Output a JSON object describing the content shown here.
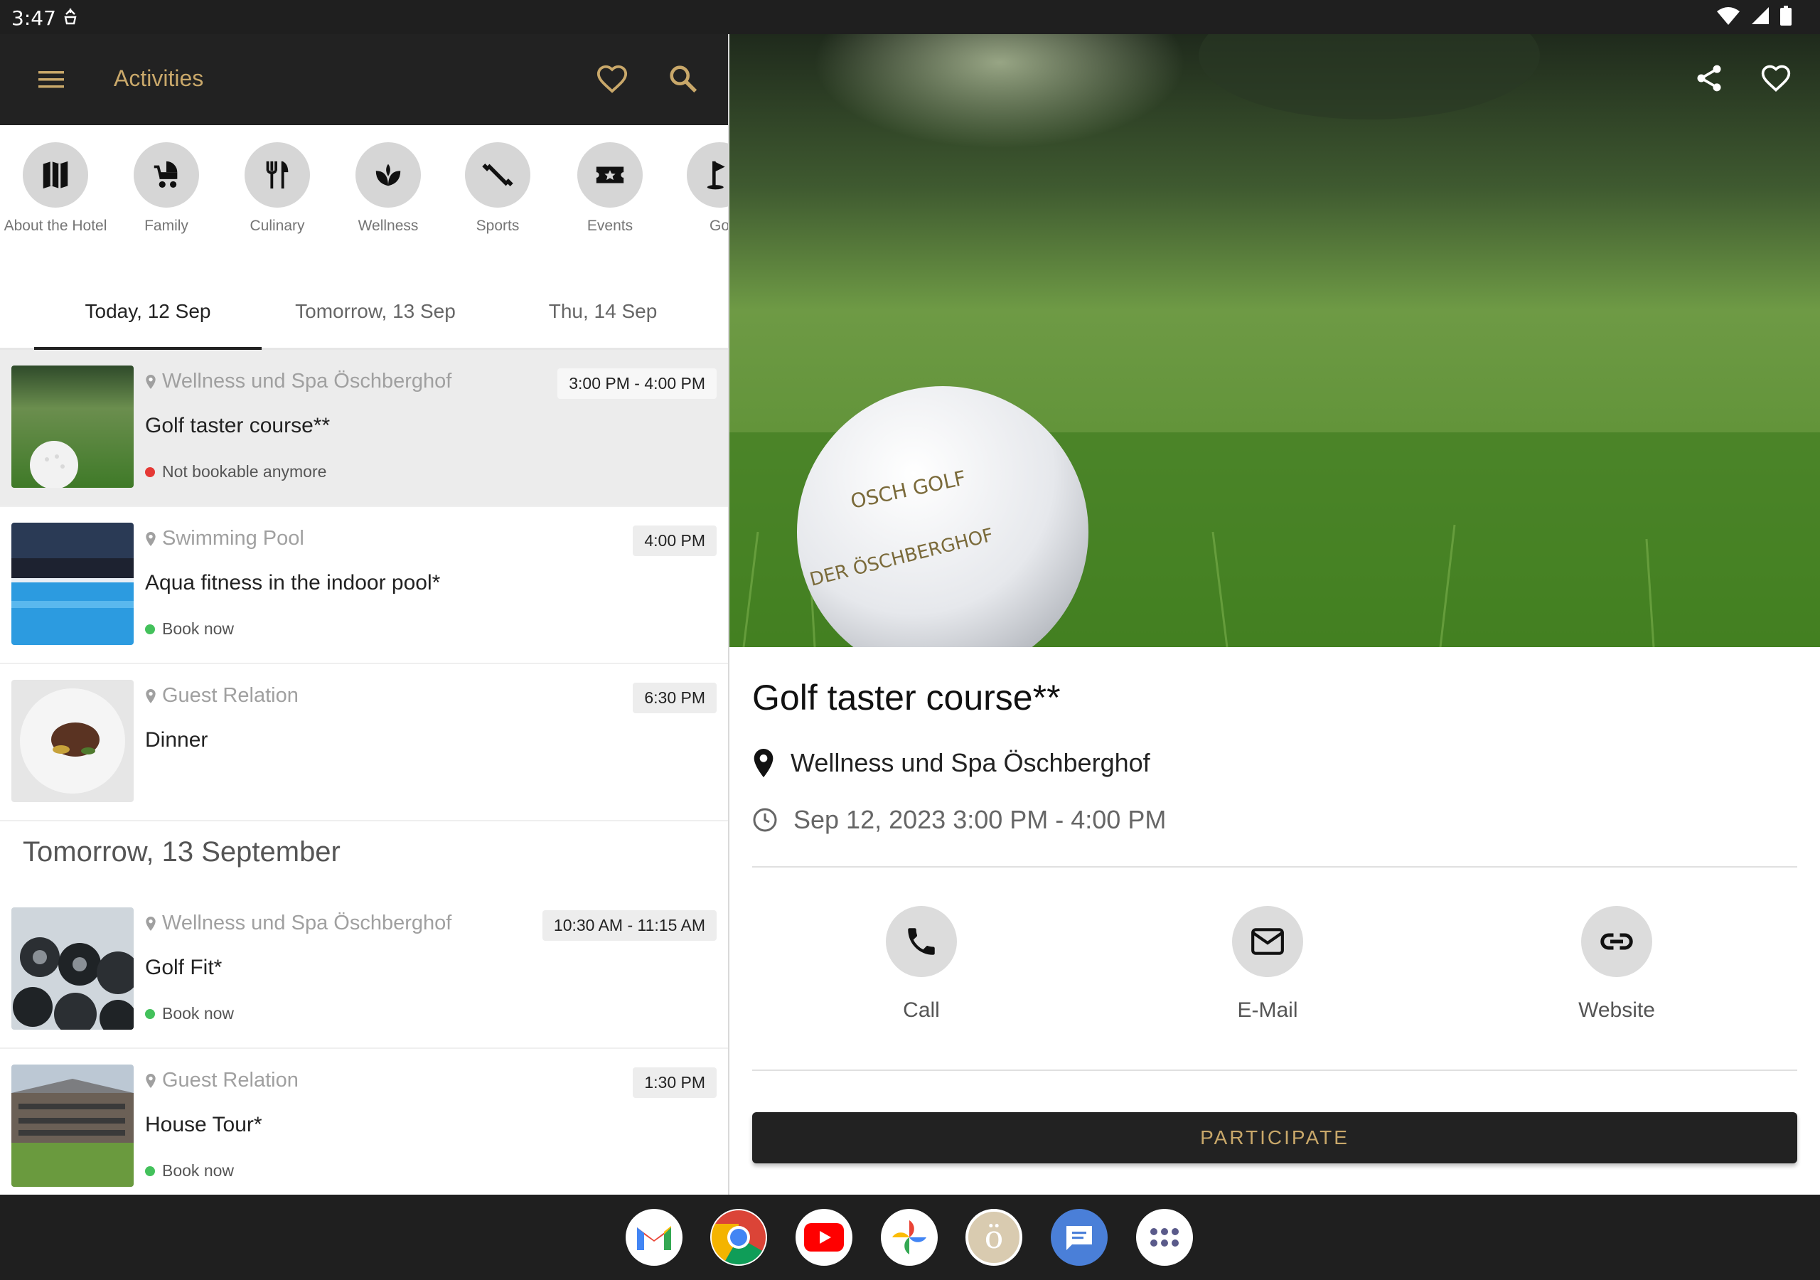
{
  "status_bar": {
    "time": "3:47"
  },
  "app_bar": {
    "title": "Activities"
  },
  "categories": [
    {
      "label": "About the Hotel",
      "icon": "map-icon"
    },
    {
      "label": "Family",
      "icon": "stroller-icon"
    },
    {
      "label": "Culinary",
      "icon": "cutlery-icon"
    },
    {
      "label": "Wellness",
      "icon": "lotus-icon"
    },
    {
      "label": "Sports",
      "icon": "dumbbell-icon"
    },
    {
      "label": "Events",
      "icon": "ticket-icon"
    },
    {
      "label": "Go",
      "icon": "golf-flag-icon"
    }
  ],
  "tabs": [
    {
      "label": "Today, 12 Sep",
      "active": true
    },
    {
      "label": "Tomorrow, 13 Sep",
      "active": false
    },
    {
      "label": "Thu, 14 Sep",
      "active": false
    }
  ],
  "today_items": [
    {
      "location": "Wellness und Spa Öschberghof",
      "time": "3:00 PM - 4:00 PM",
      "title": "Golf taster course**",
      "status": "Not bookable anymore",
      "status_color": "#e53935",
      "selected": true
    },
    {
      "location": "Swimming Pool",
      "time": "4:00 PM",
      "title": "Aqua fitness in the indoor pool*",
      "status": "Book now",
      "status_color": "#43c15b",
      "selected": false
    },
    {
      "location": "Guest Relation",
      "time": "6:30 PM",
      "title": "Dinner",
      "status": "",
      "status_color": "",
      "selected": false
    }
  ],
  "section_tomorrow": "Tomorrow, 13 September",
  "tomorrow_items": [
    {
      "location": "Wellness und Spa Öschberghof",
      "time": "10:30 AM - 11:15 AM",
      "title": "Golf Fit*",
      "status": "Book now",
      "status_color": "#43c15b"
    },
    {
      "location": "Guest Relation",
      "time": "1:30 PM",
      "title": "House Tour*",
      "status": "Book now",
      "status_color": "#43c15b"
    }
  ],
  "detail": {
    "title": "Golf taster course**",
    "location": "Wellness und Spa Öschberghof",
    "datetime": "Sep 12, 2023 3:00 PM - 4:00 PM",
    "contacts": [
      {
        "label": "Call",
        "icon": "phone-icon"
      },
      {
        "label": "E-Mail",
        "icon": "mail-icon"
      },
      {
        "label": "Website",
        "icon": "link-icon"
      }
    ],
    "participate_label": "PARTICIPATE",
    "ball_text_1": "OSCH GOLF",
    "ball_text_2": "DER ÖSCHBERGHOF"
  },
  "dock": [
    {
      "name": "gmail-app-icon"
    },
    {
      "name": "chrome-app-icon"
    },
    {
      "name": "youtube-app-icon"
    },
    {
      "name": "photos-app-icon"
    },
    {
      "name": "oschberghof-app-icon",
      "glyph": "ö"
    },
    {
      "name": "messages-app-icon"
    },
    {
      "name": "app-drawer-icon"
    }
  ],
  "colors": {
    "accent_gold": "#c9a86a",
    "app_bar": "#222222",
    "available": "#43c15b",
    "unavailable": "#e53935"
  }
}
